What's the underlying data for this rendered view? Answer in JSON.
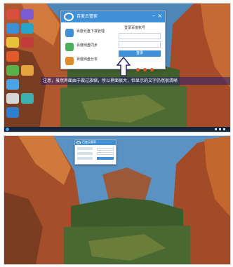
{
  "colors": {
    "sky": "#4f86b8",
    "cliff": "#a4522e",
    "forest": "#3f5f2c",
    "app_accent": "#3f90d6",
    "annotation": "#2f2470"
  },
  "top": {
    "app": {
      "title": "百度云管家",
      "window_buttons": {
        "minimize": "–",
        "close": "×"
      },
      "menu_items": [
        {
          "label": "百度云盘下载管理",
          "icon": "cloud-drive-icon"
        },
        {
          "label": "百度网盘同步",
          "icon": "sync-icon"
        },
        {
          "label": "百度网盘分享",
          "icon": "share-icon"
        }
      ],
      "login": {
        "title": "登录百度账号",
        "button": "登录"
      }
    },
    "annotation": "注意，虽然界面由于做过放缩，所以界面很大，但显示的文字仍然很清晰"
  },
  "bottom": {
    "app": {
      "title": "百度云管家"
    }
  }
}
